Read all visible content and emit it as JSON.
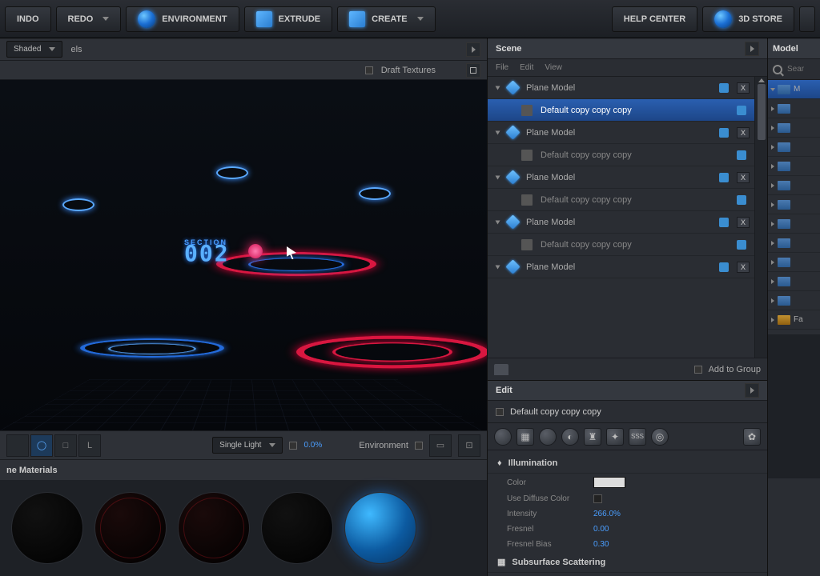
{
  "topbar": {
    "undo": "INDO",
    "redo": "REDO",
    "environment": "ENVIRONMENT",
    "extrude": "EXTRUDE",
    "create": "CREATE",
    "help_center": "HELP CENTER",
    "store": "3D STORE"
  },
  "viewport": {
    "shading_mode": "Shaded",
    "labels_toggle": "els",
    "draft_textures": "Draft Textures",
    "section_label": "SECTION",
    "section_number": "002"
  },
  "vpbottom": {
    "light_mode": "Single Light",
    "light_pct": "0.0%",
    "env_label": "Environment"
  },
  "materials": {
    "title": "ne Materials"
  },
  "scene": {
    "title": "Scene",
    "menu": {
      "file": "File",
      "edit": "Edit",
      "view": "View"
    },
    "add_to_group": "Add to Group",
    "items": [
      {
        "name": "Plane Model",
        "child": "Default copy copy copy",
        "selected": true
      },
      {
        "name": "Plane Model",
        "child": "Default copy copy copy"
      },
      {
        "name": "Plane Model",
        "child": "Default copy copy copy"
      },
      {
        "name": "Plane Model",
        "child": "Default copy copy copy"
      },
      {
        "name": "Plane Model"
      }
    ]
  },
  "edit": {
    "title": "Edit",
    "object_name": "Default copy copy copy"
  },
  "illumination": {
    "title": "Illumination",
    "color_label": "Color",
    "use_diffuse_label": "Use Diffuse Color",
    "intensity_label": "Intensity",
    "intensity_value": "266.0%",
    "fresnel_label": "Fresnel",
    "fresnel_value": "0.00",
    "fresnel_bias_label": "Fresnel Bias",
    "fresnel_bias_value": "0.30"
  },
  "subsurface": {
    "title": "Subsurface Scattering"
  },
  "model_panel": {
    "title": "Model",
    "search_placeholder": "Sear",
    "root": "M",
    "favorites": "Fa"
  }
}
